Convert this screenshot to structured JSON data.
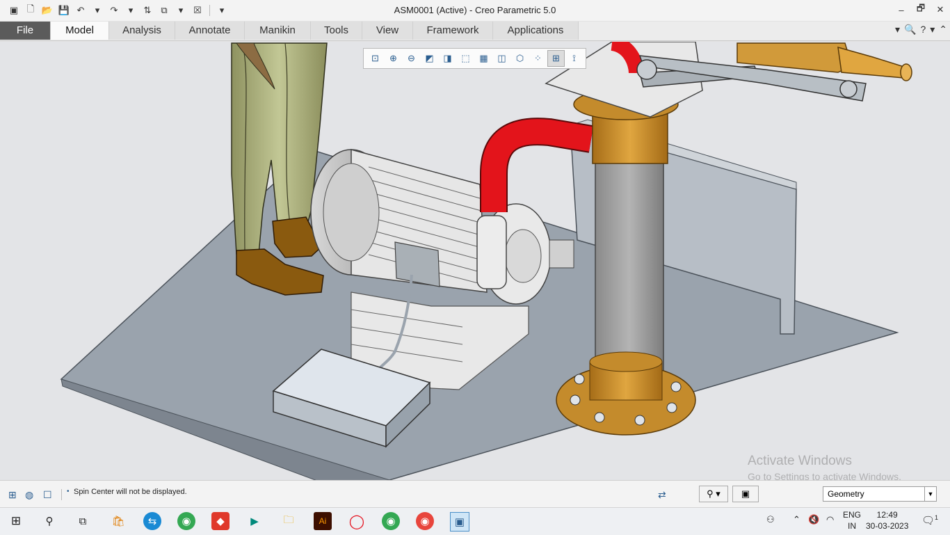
{
  "window": {
    "title": "ASM0001 (Active) - Creo Parametric 5.0",
    "controls": [
      "–",
      "🗗",
      "✕"
    ]
  },
  "quick_access": [
    "▣",
    "🗋",
    "📂",
    "💾",
    "↶",
    "▾",
    "↷",
    "▾",
    "⇅",
    "⧉",
    "▾",
    "☒",
    "▾"
  ],
  "ribbon": {
    "tabs": [
      {
        "label": "File",
        "name": "tab-file"
      },
      {
        "label": "Model",
        "name": "tab-model"
      },
      {
        "label": "Analysis",
        "name": "tab-analysis"
      },
      {
        "label": "Annotate",
        "name": "tab-annotate"
      },
      {
        "label": "Manikin",
        "name": "tab-manikin"
      },
      {
        "label": "Tools",
        "name": "tab-tools"
      },
      {
        "label": "View",
        "name": "tab-view"
      },
      {
        "label": "Framework",
        "name": "tab-framework"
      },
      {
        "label": "Applications",
        "name": "tab-applications"
      }
    ],
    "active_tab": "Model",
    "right_tools": [
      "▾",
      "🔍",
      "?",
      "▾",
      "⌃"
    ]
  },
  "view_toolbar": [
    "⊡",
    "⊕",
    "⊖",
    "◩",
    "◨",
    "⬚",
    "▦",
    "◫",
    "⬡",
    "⁘",
    "⊞",
    "⟟"
  ],
  "status": {
    "message": "Spin Center will not be displayed.",
    "selection_filter": "Geometry"
  },
  "watermark": {
    "line1": "Activate Windows",
    "line2": "Go to Settings to activate Windows."
  },
  "taskbar": {
    "language_top": "ENG",
    "language_bottom": "IN",
    "time": "12:49",
    "date": "30-03-2023",
    "notification_count": "1"
  },
  "colors": {
    "accent": "#2a5d8f",
    "file_tab": "#5b5b5b",
    "pipe_red": "#e3141b",
    "brass": "#c48b2c",
    "plate": "#9aa3ad"
  }
}
